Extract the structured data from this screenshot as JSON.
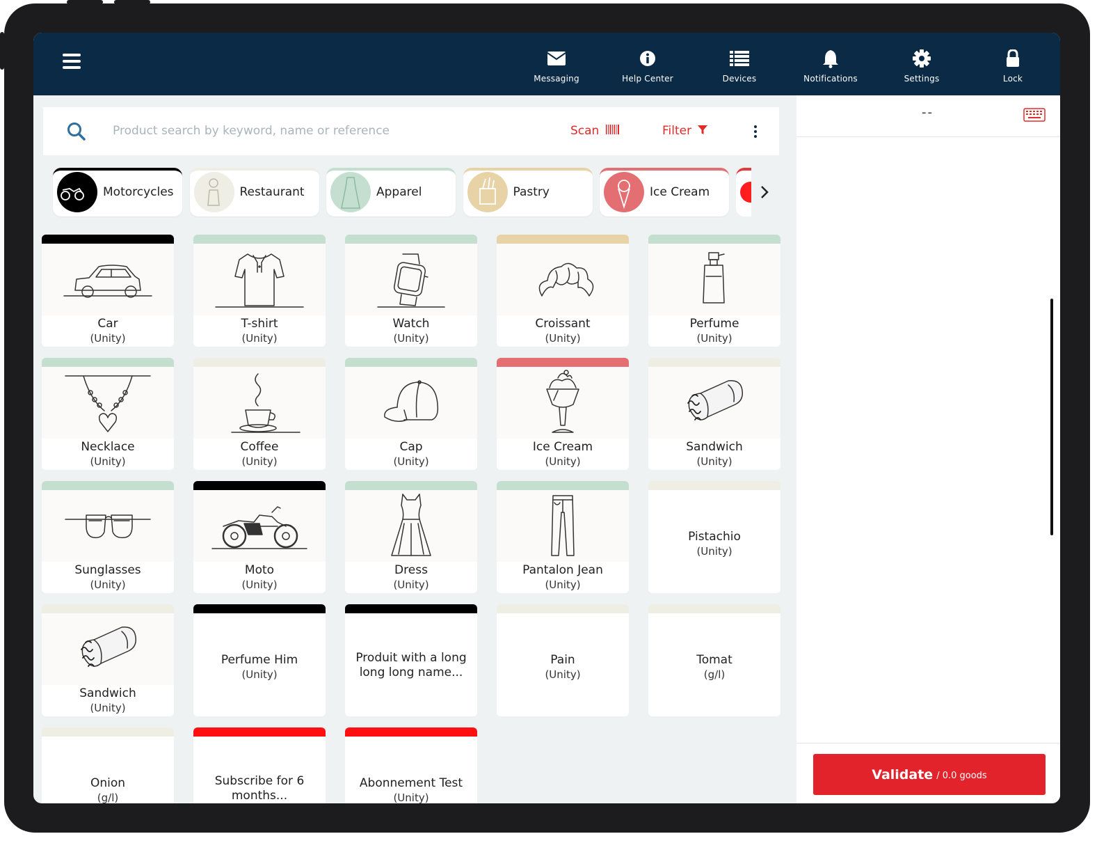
{
  "header": {
    "nav": [
      {
        "label": "Messaging",
        "icon": "envelope-icon"
      },
      {
        "label": "Help Center",
        "icon": "info-icon"
      },
      {
        "label": "Devices",
        "icon": "list-icon"
      },
      {
        "label": "Notifications",
        "icon": "bell-icon"
      },
      {
        "label": "Settings",
        "icon": "gear-icon"
      },
      {
        "label": "Lock",
        "icon": "lock-icon"
      }
    ],
    "background": "#0b2a45"
  },
  "search": {
    "placeholder": "Product search by keyword, name or reference",
    "scan_label": "Scan",
    "filter_label": "Filter"
  },
  "categories": [
    {
      "label": "Motorcycles",
      "color": "#000000"
    },
    {
      "label": "Restaurant",
      "color": "#eeeee4"
    },
    {
      "label": "Apparel",
      "color": "#c4dfcf"
    },
    {
      "label": "Pastry",
      "color": "#e8d3a6"
    },
    {
      "label": "Ice Cream",
      "color": "#e36f73"
    }
  ],
  "products": [
    {
      "name": "Car",
      "unit": "(Unity)",
      "color": "#000000",
      "icon": "car"
    },
    {
      "name": "T-shirt",
      "unit": "(Unity)",
      "color": "#c4dfcf",
      "icon": "tshirt"
    },
    {
      "name": "Watch",
      "unit": "(Unity)",
      "color": "#c4dfcf",
      "icon": "watch"
    },
    {
      "name": "Croissant",
      "unit": "(Unity)",
      "color": "#e8d3a6",
      "icon": "croissant"
    },
    {
      "name": "Perfume",
      "unit": "(Unity)",
      "color": "#c4dfcf",
      "icon": "perfume"
    },
    {
      "name": "Necklace",
      "unit": "(Unity)",
      "color": "#c4dfcf",
      "icon": "necklace"
    },
    {
      "name": "Coffee",
      "unit": "(Unity)",
      "color": "#eeeee4",
      "icon": "coffee"
    },
    {
      "name": "Cap",
      "unit": "(Unity)",
      "color": "#c4dfcf",
      "icon": "cap"
    },
    {
      "name": "Ice Cream",
      "unit": "(Unity)",
      "color": "#e36f73",
      "icon": "icecream"
    },
    {
      "name": "Sandwich",
      "unit": "(Unity)",
      "color": "#eeeee4",
      "icon": "sandwich"
    },
    {
      "name": "Sunglasses",
      "unit": "(Unity)",
      "color": "#c4dfcf",
      "icon": "sunglasses"
    },
    {
      "name": "Moto",
      "unit": "(Unity)",
      "color": "#000000",
      "icon": "moto"
    },
    {
      "name": "Dress",
      "unit": "(Unity)",
      "color": "#c4dfcf",
      "icon": "dress"
    },
    {
      "name": "Pantalon Jean",
      "unit": "(Unity)",
      "color": "#c4dfcf",
      "icon": "jeans"
    },
    {
      "name": "Pistachio",
      "unit": "(Unity)",
      "color": "#eeeee4",
      "icon": null
    },
    {
      "name": "Sandwich",
      "unit": "(Unity)",
      "color": "#eeeee4",
      "icon": "sandwich"
    },
    {
      "name": "Perfume Him",
      "unit": "(Unity)",
      "color": "#000000",
      "icon": null
    },
    {
      "name": "Produit with a long long long name...",
      "unit": "",
      "color": "#000000",
      "icon": null
    },
    {
      "name": "Pain",
      "unit": "(Unity)",
      "color": "#eeeee4",
      "icon": null
    },
    {
      "name": "Tomat",
      "unit": "(g/l)",
      "color": "#eeeee4",
      "icon": null
    },
    {
      "name": "Onion",
      "unit": "(g/l)",
      "color": "#eeeee4",
      "icon": null
    },
    {
      "name": "Subscribe for 6 months...",
      "unit": "",
      "color": "#ff1010",
      "icon": null
    },
    {
      "name": "Abonnement Test",
      "unit": "(Unity)",
      "color": "#ff1010",
      "icon": null
    }
  ],
  "cart": {
    "display": "--",
    "validate_label": "Validate",
    "validate_sub": "/ 0.0 goods",
    "accent": "#e3232b"
  }
}
